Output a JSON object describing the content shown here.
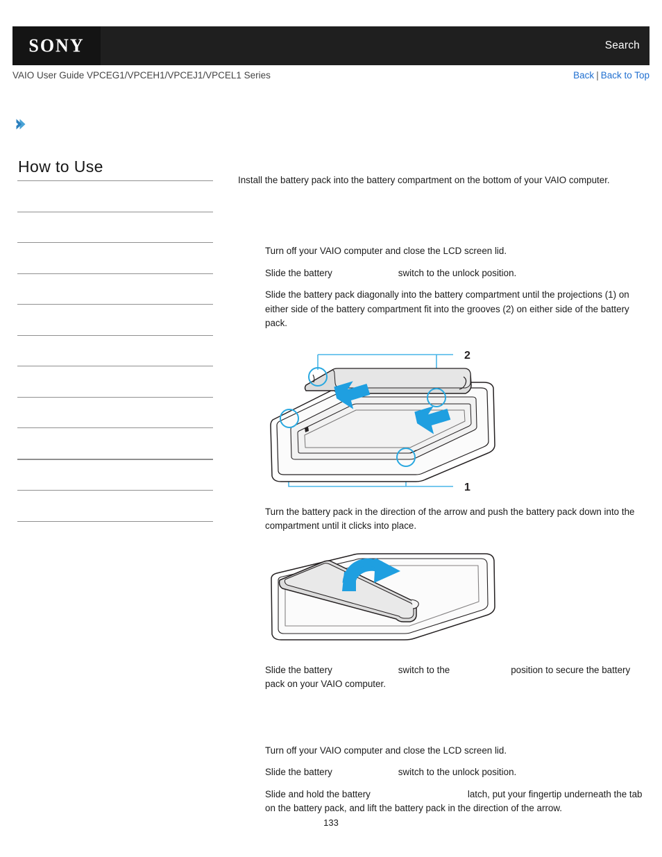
{
  "header": {
    "logo_text": "SONY",
    "search_label": "Search"
  },
  "subheader": {
    "guide_title": "VAIO User Guide VPCEG1/VPCEH1/VPCEJ1/VPCEL1 Series",
    "back_label": "Back",
    "separator": "|",
    "back_to_top_label": "Back to Top"
  },
  "breadcrumb": {
    "icon": "chevron-right-icon"
  },
  "sidebar": {
    "title": "How to Use",
    "items": [
      {
        "label": ""
      },
      {
        "label": ""
      },
      {
        "label": ""
      },
      {
        "label": ""
      },
      {
        "label": ""
      },
      {
        "label": ""
      },
      {
        "label": ""
      },
      {
        "label": ""
      },
      {
        "label": ""
      },
      {
        "label": ""
      },
      {
        "label": ""
      }
    ]
  },
  "main": {
    "intro": "Install the battery pack into the battery compartment on the bottom of your VAIO computer.",
    "install_section": {
      "heading": "",
      "steps": [
        {
          "text_parts": [
            "Turn off your VAIO computer and close the LCD screen lid."
          ]
        },
        {
          "text_parts": [
            "Slide the battery",
            "switch to the unlock position."
          ]
        },
        {
          "text_parts": [
            "Slide the battery pack diagonally into the battery compartment until the projections (1) on either side of the battery compartment fit into the grooves (2) on either side of the battery pack."
          ]
        }
      ],
      "step_after_figure1": "Turn the battery pack in the direction of the arrow and push the battery pack down into the compartment until it clicks into place.",
      "step_after_figure2_parts": [
        "Slide the battery",
        "switch to the",
        "position to secure the battery pack on your VAIO computer."
      ]
    },
    "remove_section": {
      "heading": "",
      "steps": [
        {
          "text_parts": [
            "Turn off your VAIO computer and close the LCD screen lid."
          ]
        },
        {
          "text_parts": [
            "Slide the battery",
            "switch to the unlock position."
          ]
        },
        {
          "text_parts": [
            "Slide and hold the battery",
            "latch, put your fingertip underneath the tab on the battery pack, and lift the battery pack in the direction of the arrow."
          ]
        }
      ]
    },
    "figure_install": {
      "name": "battery-install-diagram",
      "callout_1": "1",
      "callout_2": "2",
      "description": "Battery pack being slid diagonally into the compartment on the bottom of a closed VAIO laptop; blue arrows point to projections (1) and grooves (2)."
    },
    "figure_rotate": {
      "name": "battery-rotate-diagram",
      "description": "Battery pack seated in the compartment with a curved blue arrow showing the rotation direction to click it into place."
    }
  },
  "footer": {
    "page_number": "133"
  },
  "colors": {
    "header_bg": "#1f1f1f",
    "logo_bg": "#141414",
    "link_blue": "#1f6fd0",
    "accent_blue": "#3a9fd8",
    "arrow_blue": "#1a9ce0",
    "divider_gray": "#8f8f8f",
    "diagram_line": "#231f20",
    "diagram_fill": "#dcdcdc"
  }
}
